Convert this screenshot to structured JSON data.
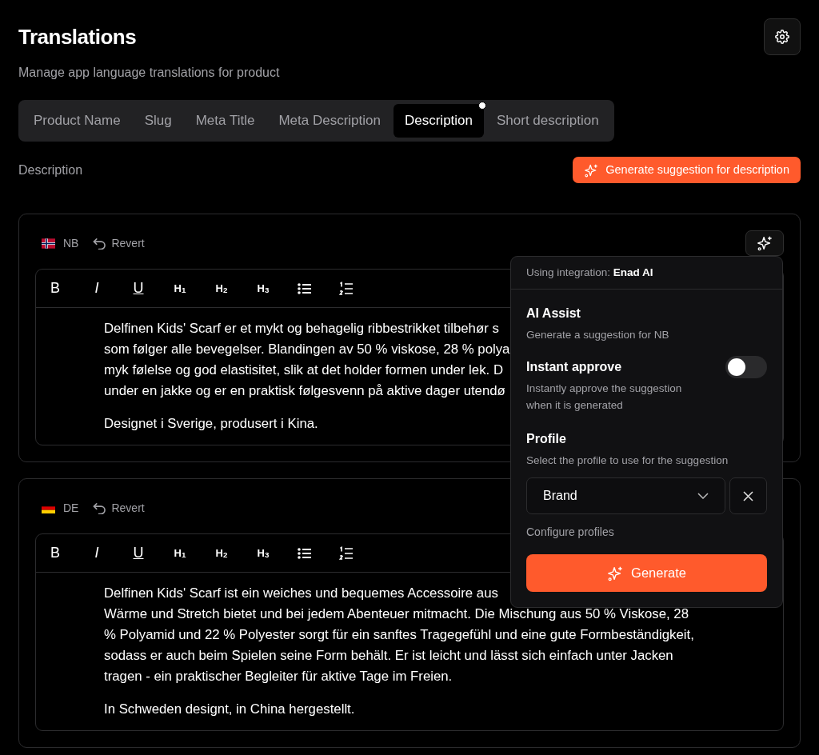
{
  "page": {
    "title": "Translations",
    "subtitle": "Manage app language translations for product"
  },
  "tabs": [
    {
      "label": "Product Name",
      "selected": false,
      "modified": false
    },
    {
      "label": "Slug",
      "selected": false,
      "modified": false
    },
    {
      "label": "Meta Title",
      "selected": false,
      "modified": false
    },
    {
      "label": "Meta Description",
      "selected": false,
      "modified": false
    },
    {
      "label": "Description",
      "selected": true,
      "modified": true
    },
    {
      "label": "Short description",
      "selected": false,
      "modified": false
    }
  ],
  "section": {
    "label": "Description",
    "generate_button": "Generate suggestion for description"
  },
  "editors": [
    {
      "kind": "norway",
      "language": "NB",
      "revert": "Revert",
      "toolbar": [
        {
          "kind": "bold",
          "label": "B"
        },
        {
          "kind": "italic",
          "label": "I"
        },
        {
          "kind": "underline",
          "label": "U"
        },
        {
          "kind": "heading",
          "label": "H$_{1}$"
        },
        {
          "kind": "heading",
          "label": "H$_{2}$"
        },
        {
          "kind": "heading",
          "label": "H$_{3}$"
        },
        {
          "kind": "bullet-list"
        },
        {
          "kind": "ordered-list"
        }
      ],
      "paragraphs": [
        [
          "Delfinen Kids' Scarf er et mykt og behagelig ribbestrikket tilbehør s",
          "som følger alle bevegelser. Blandingen av 50 % viskose, 28 % polya",
          "myk følelse og god elastisitet, slik at det holder formen under lek. D",
          "under en jakke og er en praktisk følgesvenn på aktive dager utendø"
        ],
        [
          "Designet i Sverige, produsert i Kina."
        ]
      ]
    },
    {
      "kind": "germany",
      "language": "DE",
      "revert": "Revert",
      "toolbar": [
        {
          "kind": "bold",
          "label": "B"
        },
        {
          "kind": "italic",
          "label": "I"
        },
        {
          "kind": "underline",
          "label": "U"
        },
        {
          "kind": "heading",
          "label": "H$_{1}$"
        },
        {
          "kind": "heading",
          "label": "H$_{2}$"
        },
        {
          "kind": "heading",
          "label": "H$_{3}$"
        },
        {
          "kind": "bullet-list"
        },
        {
          "kind": "ordered-list"
        }
      ],
      "paragraphs": [
        [
          "Delfinen Kids' Scarf ist ein weiches und bequemes Accessoire aus",
          "Wärme und Stretch bietet und bei jedem Abenteuer mitmacht. Die Mischung aus 50 % Viskose, 28",
          "% Polyamid und 22 % Polyester sorgt für ein sanftes Tragegefühl und eine gute Formbeständigkeit,",
          "sodass er auch beim Spielen seine Form behält. Er ist leicht und lässt sich einfach unter Jacken",
          "tragen - ein praktischer Begleiter für aktive Tage im Freien."
        ],
        [
          "In Schweden designt, in China hergestellt."
        ]
      ]
    }
  ],
  "ai_popover": {
    "integration": "Using integration: **Enad AI**",
    "title": "AI Assist",
    "subtitle": "Generate a suggestion for NB",
    "instant_approve": {
      "label": "Instant approve",
      "description": "Instantly approve the suggestion when it is generated",
      "on": false
    },
    "profile": {
      "label": "Profile",
      "description": "Select the profile to use for the suggestion",
      "value": "Brand"
    },
    "configure_link": "Configure profiles",
    "generate_button": "Generate"
  }
}
